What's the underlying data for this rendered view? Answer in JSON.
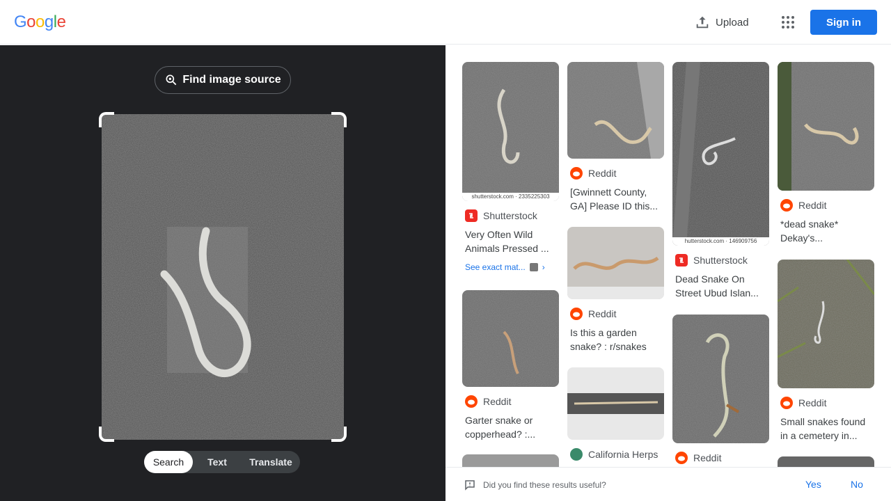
{
  "header": {
    "logo_letters": [
      {
        "ch": "G",
        "color": "#4285F4"
      },
      {
        "ch": "o",
        "color": "#EA4335"
      },
      {
        "ch": "o",
        "color": "#FBBC05"
      },
      {
        "ch": "g",
        "color": "#4285F4"
      },
      {
        "ch": "l",
        "color": "#34A853"
      },
      {
        "ch": "e",
        "color": "#EA4335"
      }
    ],
    "upload_label": "Upload",
    "signin_label": "Sign in",
    "apps_icon": "grid-dots-icon"
  },
  "lens": {
    "find_source_label": "Find image source",
    "tabs": [
      {
        "label": "Search",
        "active": true
      },
      {
        "label": "Text",
        "active": false
      },
      {
        "label": "Translate",
        "active": false
      }
    ]
  },
  "results": [
    {
      "source": "Shutterstock",
      "icon": "shutterstock",
      "title": "Very Often Wild Animals Pressed ...",
      "watermark": "shutterstock.com · 2335225303",
      "exact": "See exact mat..."
    },
    {
      "source": "Reddit",
      "icon": "reddit",
      "title": "Garter snake or copperhead? :..."
    },
    {
      "source": "Reddit",
      "icon": "reddit",
      "title": "[Gwinnett County, GA] Please ID this..."
    },
    {
      "source": "Reddit",
      "icon": "reddit",
      "title": "Is this a garden snake? : r/snakes"
    },
    {
      "source": "California Herps",
      "icon": "calherps",
      "title": ""
    },
    {
      "source": "Shutterstock",
      "icon": "shutterstock",
      "title": "Dead Snake On Street Ubud Islan...",
      "watermark": "hutterstock.com · 146909756"
    },
    {
      "source": "Reddit",
      "icon": "reddit",
      "title": ""
    },
    {
      "source": "Reddit",
      "icon": "reddit",
      "title": "*dead snake* Dekay's..."
    },
    {
      "source": "Reddit",
      "icon": "reddit",
      "title": "Small snakes found in a cemetery in..."
    }
  ],
  "feedback": {
    "question": "Did you find these results useful?",
    "yes": "Yes",
    "no": "No"
  },
  "colors": {
    "accent": "#1a73e8",
    "dark_panel": "#202124",
    "reddit": "#FF4500",
    "shutterstock": "#EE2B24"
  }
}
